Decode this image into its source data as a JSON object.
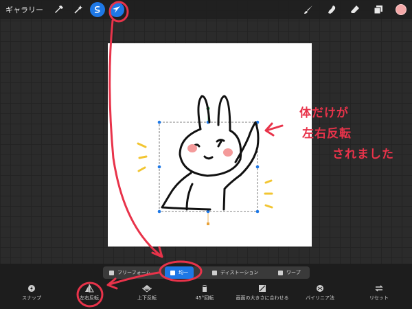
{
  "topbar": {
    "gallery_label": "ギャラリー",
    "left_tools": [
      "wrench-icon",
      "magic-wand-icon",
      "selection-icon",
      "transform-arrow-icon"
    ],
    "right_tools": [
      "brush-icon",
      "smudge-icon",
      "eraser-icon",
      "layers-icon"
    ],
    "current_color": "#f4a8a8"
  },
  "annotation": {
    "line1": "体だけが",
    "line2": "左右反転",
    "line3": "されました",
    "color": "#e8334a"
  },
  "transform_modes": {
    "items": [
      {
        "label": "フリーフォーム",
        "icon": "freeform-icon"
      },
      {
        "label": "均一",
        "icon": "uniform-icon",
        "selected": true
      },
      {
        "label": "ディストーション",
        "icon": "distortion-icon"
      },
      {
        "label": "ワープ",
        "icon": "warp-icon"
      }
    ]
  },
  "actions": {
    "items": [
      {
        "label": "スナップ",
        "icon": "snap-icon"
      },
      {
        "label": "左右反転",
        "icon": "flip-horizontal-icon"
      },
      {
        "label": "上下反転",
        "icon": "flip-vertical-icon"
      },
      {
        "label": "45°回転",
        "icon": "rotate-icon"
      },
      {
        "label": "画面の大きさに合わせる",
        "icon": "fit-to-screen-icon"
      },
      {
        "label": "バイリニア法",
        "icon": "interpolation-icon"
      },
      {
        "label": "リセット",
        "icon": "reset-icon"
      }
    ]
  },
  "accent_color": "#1e78e6"
}
